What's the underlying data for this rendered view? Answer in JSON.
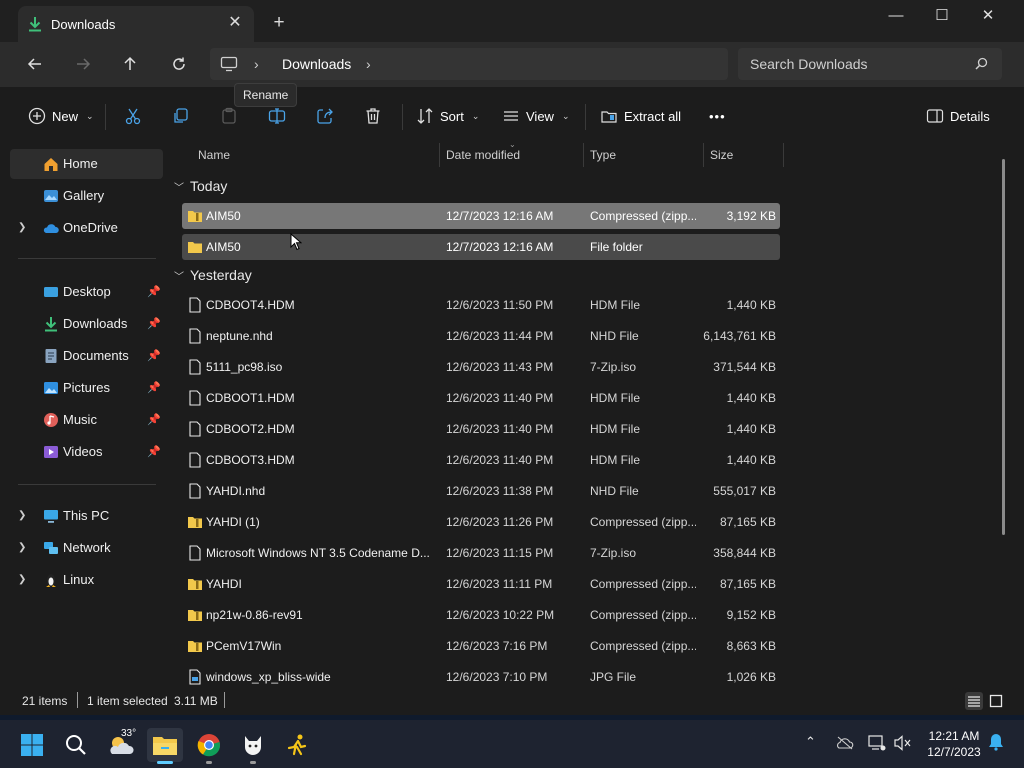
{
  "window": {
    "tab_title": "Downloads",
    "tab_close": "✕",
    "new_tab": "+",
    "controls": {
      "minimize": "—",
      "maximize": "☐",
      "close": "✕"
    }
  },
  "address": {
    "breadcrumb": "Downloads",
    "search_placeholder": "Search Downloads"
  },
  "toolbar": {
    "new_label": "New",
    "sort_label": "Sort",
    "view_label": "View",
    "extract_label": "Extract all",
    "more_label": "•••",
    "details_label": "Details",
    "tooltip": "Rename"
  },
  "sidebar": {
    "home": "Home",
    "gallery": "Gallery",
    "onedrive": "OneDrive",
    "desktop": "Desktop",
    "downloads": "Downloads",
    "documents": "Documents",
    "pictures": "Pictures",
    "music": "Music",
    "videos": "Videos",
    "this_pc": "This PC",
    "network": "Network",
    "linux": "Linux"
  },
  "columns": {
    "name": "Name",
    "date": "Date modified",
    "type": "Type",
    "size": "Size"
  },
  "groups": {
    "today": "Today",
    "yesterday": "Yesterday"
  },
  "rows": [
    {
      "name": "AIM50",
      "date": "12/7/2023 12:16 AM",
      "type": "Compressed (zipp...",
      "size": "3,192 KB",
      "icon": "zip-folder-icon"
    },
    {
      "name": "AIM50",
      "date": "12/7/2023 12:16 AM",
      "type": "File folder",
      "size": "",
      "icon": "folder-icon"
    },
    {
      "name": "CDBOOT4.HDM",
      "date": "12/6/2023 11:50 PM",
      "type": "HDM File",
      "size": "1,440 KB",
      "icon": "file-icon"
    },
    {
      "name": "neptune.nhd",
      "date": "12/6/2023 11:44 PM",
      "type": "NHD File",
      "size": "6,143,761 KB",
      "icon": "file-icon"
    },
    {
      "name": "5111_pc98.iso",
      "date": "12/6/2023 11:43 PM",
      "type": "7-Zip.iso",
      "size": "371,544 KB",
      "icon": "file-icon"
    },
    {
      "name": "CDBOOT1.HDM",
      "date": "12/6/2023 11:40 PM",
      "type": "HDM File",
      "size": "1,440 KB",
      "icon": "file-icon"
    },
    {
      "name": "CDBOOT2.HDM",
      "date": "12/6/2023 11:40 PM",
      "type": "HDM File",
      "size": "1,440 KB",
      "icon": "file-icon"
    },
    {
      "name": "CDBOOT3.HDM",
      "date": "12/6/2023 11:40 PM",
      "type": "HDM File",
      "size": "1,440 KB",
      "icon": "file-icon"
    },
    {
      "name": "YAHDI.nhd",
      "date": "12/6/2023 11:38 PM",
      "type": "NHD File",
      "size": "555,017 KB",
      "icon": "file-icon"
    },
    {
      "name": "YAHDI (1)",
      "date": "12/6/2023 11:26 PM",
      "type": "Compressed (zipp...",
      "size": "87,165 KB",
      "icon": "zip-folder-icon"
    },
    {
      "name": "Microsoft Windows NT 3.5 Codename D...",
      "date": "12/6/2023 11:15 PM",
      "type": "7-Zip.iso",
      "size": "358,844 KB",
      "icon": "file-icon"
    },
    {
      "name": "YAHDI",
      "date": "12/6/2023 11:11 PM",
      "type": "Compressed (zipp...",
      "size": "87,165 KB",
      "icon": "zip-folder-icon"
    },
    {
      "name": "np21w-0.86-rev91",
      "date": "12/6/2023 10:22 PM",
      "type": "Compressed (zipp...",
      "size": "9,152 KB",
      "icon": "zip-folder-icon"
    },
    {
      "name": "PCemV17Win",
      "date": "12/6/2023 7:16 PM",
      "type": "Compressed (zipp...",
      "size": "8,663 KB",
      "icon": "zip-folder-icon"
    },
    {
      "name": "windows_xp_bliss-wide",
      "date": "12/6/2023 7:10 PM",
      "type": "JPG File",
      "size": "1,026 KB",
      "icon": "image-file-icon"
    }
  ],
  "status": {
    "items": "21 items",
    "selected": "1 item selected",
    "selected_size": "3.11 MB"
  },
  "taskbar": {
    "temperature": "33°",
    "time": "12:21 AM",
    "date": "12/7/2023"
  },
  "colors": {
    "accent": "#60cdff",
    "selected_row": "#777777",
    "hover_row": "#4a4a4a",
    "window_bg": "#1c1c1c"
  }
}
